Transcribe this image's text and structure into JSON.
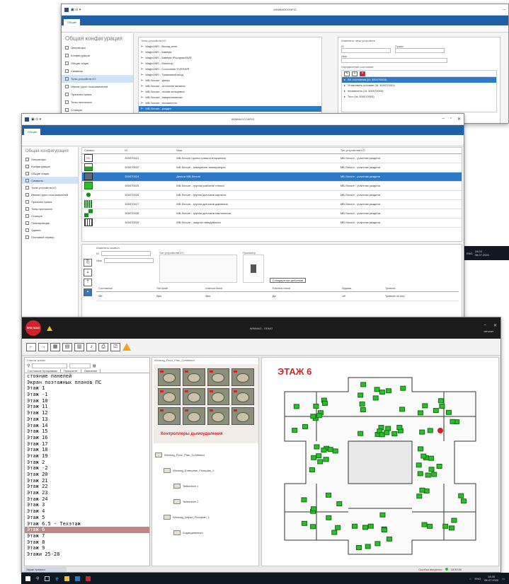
{
  "win1": {
    "title": "WINMAGCONFIG",
    "tab": "Общие",
    "side_head": "Общая конфигурация",
    "side_items": [
      "Операторы",
      "Конфигурация",
      "Общие опции",
      "Символы",
      "Типы устройств I/O",
      "Имена групп пользователей",
      "Причины тревог",
      "Типы протокола",
      "Станции"
    ],
    "list_head": "Типы устройств I/O",
    "list_items": [
      "MagicVMS - Выход реле",
      "MagicVMS - Камера",
      "MagicVMS - Камера IP/cognac/NVR",
      "MagicVMS - Монитор",
      "MagicVMS - Состояние DVR/NVR",
      "MagicVMS - Тревожный вход",
      "MB-Secure - дверь",
      "MB-Secure - источник питания",
      "MB-Secure - линия кольцевых",
      "MB-Secure - микросхемники",
      "MB-Secure - неизвестно",
      "MB-Secure - раздел"
    ],
    "edit_head": "Изменить типы устройств",
    "id_label": "ID",
    "rights_label": "Права",
    "name_label": "Имя",
    "states_head": "Определение состояния",
    "states": [
      "Alt. состояния (Id: 300070003)",
      "Установить условие (Id: 300070001)",
      "неизвестно (Id: 300070003)",
      "Тест (Id: 300070003)"
    ]
  },
  "win2": {
    "title": "WINMAGCONFIG",
    "tab": "Общие",
    "side_head": "Общая конфигурация",
    "side_items": [
      "Операторы",
      "Конфигурация",
      "Общие опции",
      "Символы",
      "Типы устройств I/O",
      "Имена групп пользователей",
      "Причины тревог",
      "Типы протокола",
      "Станции",
      "Планировщик",
      "Здания",
      "Почтовый сервер"
    ],
    "table_headers": [
      "Символ",
      "ID",
      "Имя",
      "Тип устройства I/O"
    ],
    "rows": [
      {
        "id": "300070021",
        "name": "MB-Secure группа тревоги вторжения",
        "type": "MB-Secure - участник раздела",
        "sym": "ПС"
      },
      {
        "id": "300070022",
        "name": "MB-Secure - измерение температуры",
        "type": "MB-Secure - участник раздела",
        "sym": "therm"
      },
      {
        "id": "300070024",
        "name": "Деньги MB-Secure",
        "type": "MB-Secure - участник раздела",
        "sym": "box"
      },
      {
        "id": "300070025",
        "name": "MB-Secure - группа разбитие стекла",
        "type": "MB-Secure - участник раздела",
        "sym": "green"
      },
      {
        "id": "300070026",
        "name": "MB-Secure - группа датчиков картины",
        "type": "MB-Secure - участник раздела",
        "sym": "person"
      },
      {
        "id": "300070027",
        "name": "MB-Secure - группа датчиков давления",
        "type": "MB-Secure - участник раздела",
        "sym": "press"
      },
      {
        "id": "300070028",
        "name": "MB-Secure - группа датчиков наклонения",
        "type": "MB-Secure - участник раздела",
        "sym": "tilt"
      },
      {
        "id": "300070029",
        "name": "MB-Secure - защита невидимости",
        "type": "MB-Secure - участник раздела",
        "sym": "vault"
      }
    ],
    "edit_head": "Изменить символ",
    "id_label": "ID",
    "name_label": "Имя",
    "type_label": "Тип устройства I/O",
    "preview_label": "Просмотр",
    "std_actions": "Стандартные действия",
    "state_cols": [
      "Состояние",
      "Set state",
      "Internal block",
      "External block",
      "Bypass",
      "Тревога"
    ],
    "state_vals": [
      "OK",
      "Вкл",
      "Вкл.",
      "Да",
      "off",
      "Тревога по пер"
    ],
    "tray_lang": "ENG",
    "tray_time": "18:03",
    "tray_date": "06.07.2020"
  },
  "win3": {
    "title": "WINMAG - DEMO",
    "logo_text": "WIN MAG",
    "left_head": "Список тревог",
    "col_headers": [
      "Состояние программы",
      "Приоритет",
      "Описание"
    ],
    "tree": [
      "стояние панелей",
      "Экран поэтажных планов ПС",
      "Этаж 1",
      "Этаж -1",
      "Этаж 10",
      "Этаж 11",
      "Этаж 12",
      "Этаж 13",
      "Этаж 14",
      "Этаж 15",
      "Этаж 16",
      "Этаж 17",
      "Этаж 18",
      "Этаж 19",
      "Этаж 2",
      "Этаж -2",
      "Этаж 20",
      "Этаж 21",
      "Этаж 22",
      "Этаж 23",
      "Этаж 24",
      "Этаж 3",
      "Этаж 4",
      "Этаж 5",
      "Этаж 6.5 - Техэтаж",
      "Этаж 6",
      "Этаж 7",
      "Этаж 8",
      "Этаж 9",
      "Этажи 25-28"
    ],
    "selected_tree_index": 25,
    "mid_head": "Winmag_Floor_Plan_Combined",
    "mid_caption": "Контроллеры дымоудаления",
    "mid_tree": [
      "Winmag_Floor_Plan_Combined",
      "Winmag_Enterprise_Floorplan_2",
      "Teilbereich 1",
      "Teilbereich 2",
      "Winmag_Airport_Floorplan_1",
      "Zugangsbereich"
    ],
    "floor_title": "ЭТАЖ 6",
    "bottom_tab": "Экран тревоги",
    "status_text": "Ошибка введения",
    "status_time": "18:30:50",
    "user": "winuser",
    "tray_lang": "ENG",
    "tray_time": "18:30",
    "tray_date": "06.07.2020",
    "accent": "#d2232a",
    "sensor_color": "#27c127"
  }
}
